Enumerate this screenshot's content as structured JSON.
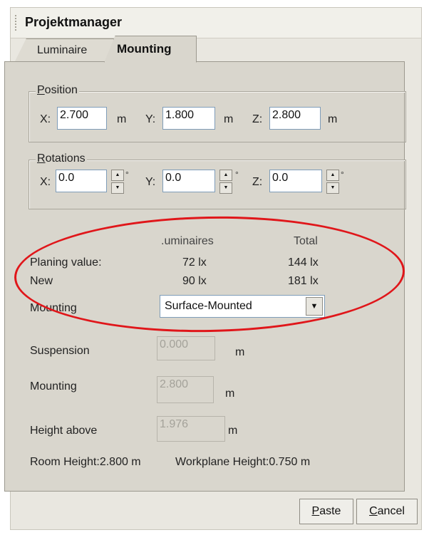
{
  "window": {
    "title": "Projektmanager"
  },
  "tabs": [
    {
      "label": "Luminaire",
      "active": false
    },
    {
      "label": "Mounting",
      "active": true
    }
  ],
  "position": {
    "group_label": "Position",
    "x_label": "X:",
    "x_value": "2.700",
    "x_unit": "m",
    "y_label": "Y:",
    "y_value": "1.800",
    "y_unit": "m",
    "z_label": "Z:",
    "z_value": "2.800",
    "z_unit": "m"
  },
  "rotations": {
    "group_label": "Rotations",
    "x_label": "X:",
    "x_value": "0.0",
    "y_label": "Y:",
    "y_value": "0.0",
    "z_label": "Z:",
    "z_value": "0.0",
    "deg_symbol": "°"
  },
  "summary": {
    "col_luminaires": ".uminaires",
    "col_total": "Total",
    "rows": [
      {
        "label": "Planing value:",
        "luminaires": "72 lx",
        "total": "144 lx"
      },
      {
        "label": "New",
        "luminaires": "90 lx",
        "total": "181 lx"
      }
    ]
  },
  "mounting_type": {
    "label": "Mounting",
    "value": "Surface-Mounted"
  },
  "suspension": {
    "label": "Suspension",
    "value": "0.000",
    "unit": "m"
  },
  "mounting_height": {
    "label": "Mounting",
    "value": "2.800",
    "unit": "m"
  },
  "height_above": {
    "label": "Height above",
    "value": "1.976",
    "unit": "m"
  },
  "info": {
    "room_height": "Room Height:2.800 m",
    "workplane_height": "Workplane Height:0.750 m"
  },
  "buttons": {
    "paste": "Paste",
    "cancel": "Cancel"
  },
  "colors": {
    "panel": "#d9d6cd",
    "highlight_ellipse": "#e0161a"
  },
  "icons": {
    "dropdown": "chevron-down-icon",
    "spin": "spin-arrows-icon"
  }
}
